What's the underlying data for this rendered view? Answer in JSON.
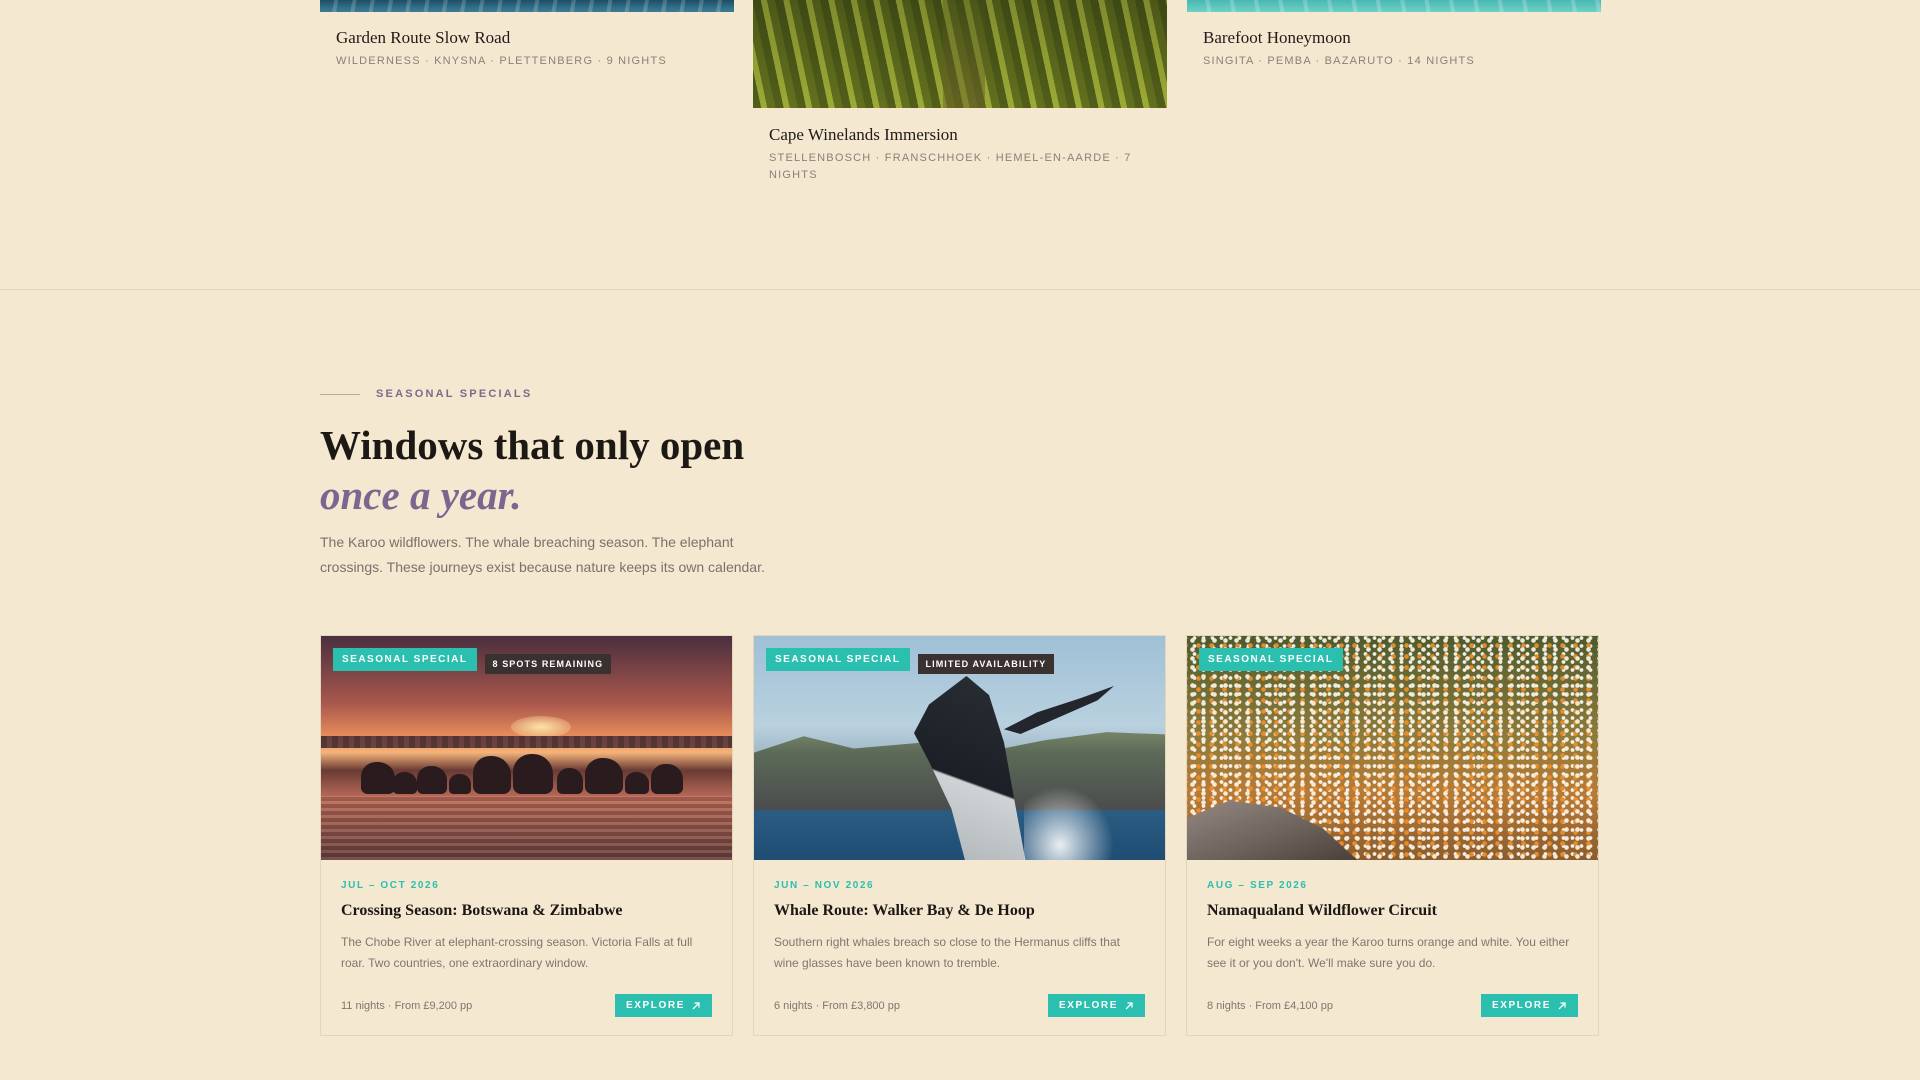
{
  "top_trips": [
    {
      "title": "Garden Route Slow Road",
      "meta": "WILDERNESS · KNYSNA · PLETTENBERG · 9 NIGHTS",
      "image": "ocean-image"
    },
    {
      "title": "Cape Winelands Immersion",
      "meta": "STELLENBOSCH · FRANSCHHOEK · HEMEL-EN-AARDE · 7 NIGHTS",
      "image": "vineyard-image"
    },
    {
      "title": "Barefoot Honeymoon",
      "meta": "SINGITA · PEMBA · BAZARUTO · 14 NIGHTS",
      "image": "lagoon-image"
    }
  ],
  "seasonal": {
    "eyebrow": "SEASONAL SPECIALS",
    "headline_line1": "Windows that only open",
    "headline_line2": "once a year.",
    "intro": "The Karoo wildflowers. The whale breaching season. The elephant crossings. These journeys exist because nature keeps its own calendar.",
    "cards": [
      {
        "badge": "SEASONAL SPECIAL",
        "tag": "8 SPOTS REMAINING",
        "dates": "JUL – OCT 2026",
        "title": "Crossing Season: Botswana & Zimbabwe",
        "description": "The Chobe River at elephant-crossing season. Victoria Falls at full roar. Two countries, one extraordinary window.",
        "price": "11 nights · From £9,200 pp",
        "cta": "EXPLORE",
        "image": "elephants-sunset-image"
      },
      {
        "badge": "SEASONAL SPECIAL",
        "tag": "LIMITED AVAILABILITY",
        "dates": "JUN – NOV 2026",
        "title": "Whale Route: Walker Bay & De Hoop",
        "description": "Southern right whales breach so close to the Hermanus cliffs that wine glasses have been known to tremble.",
        "price": "6 nights · From £3,800 pp",
        "cta": "EXPLORE",
        "image": "breaching-whale-image"
      },
      {
        "badge": "SEASONAL SPECIAL",
        "dates": "AUG – SEP 2026",
        "title": "Namaqualand Wildflower Circuit",
        "description": "For eight weeks a year the Karoo turns orange and white. You either see it or you don't. We'll make sure you do.",
        "price": "8 nights · From £4,100 pp",
        "cta": "EXPLORE",
        "image": "wildflowers-image"
      }
    ]
  },
  "colors": {
    "background": "#f5e8d1",
    "accent_teal": "#2bbfb0",
    "accent_purple": "#7b6690",
    "dark_tag": "#3a3230"
  },
  "icons": {
    "explore": "arrow-up-right-icon"
  }
}
